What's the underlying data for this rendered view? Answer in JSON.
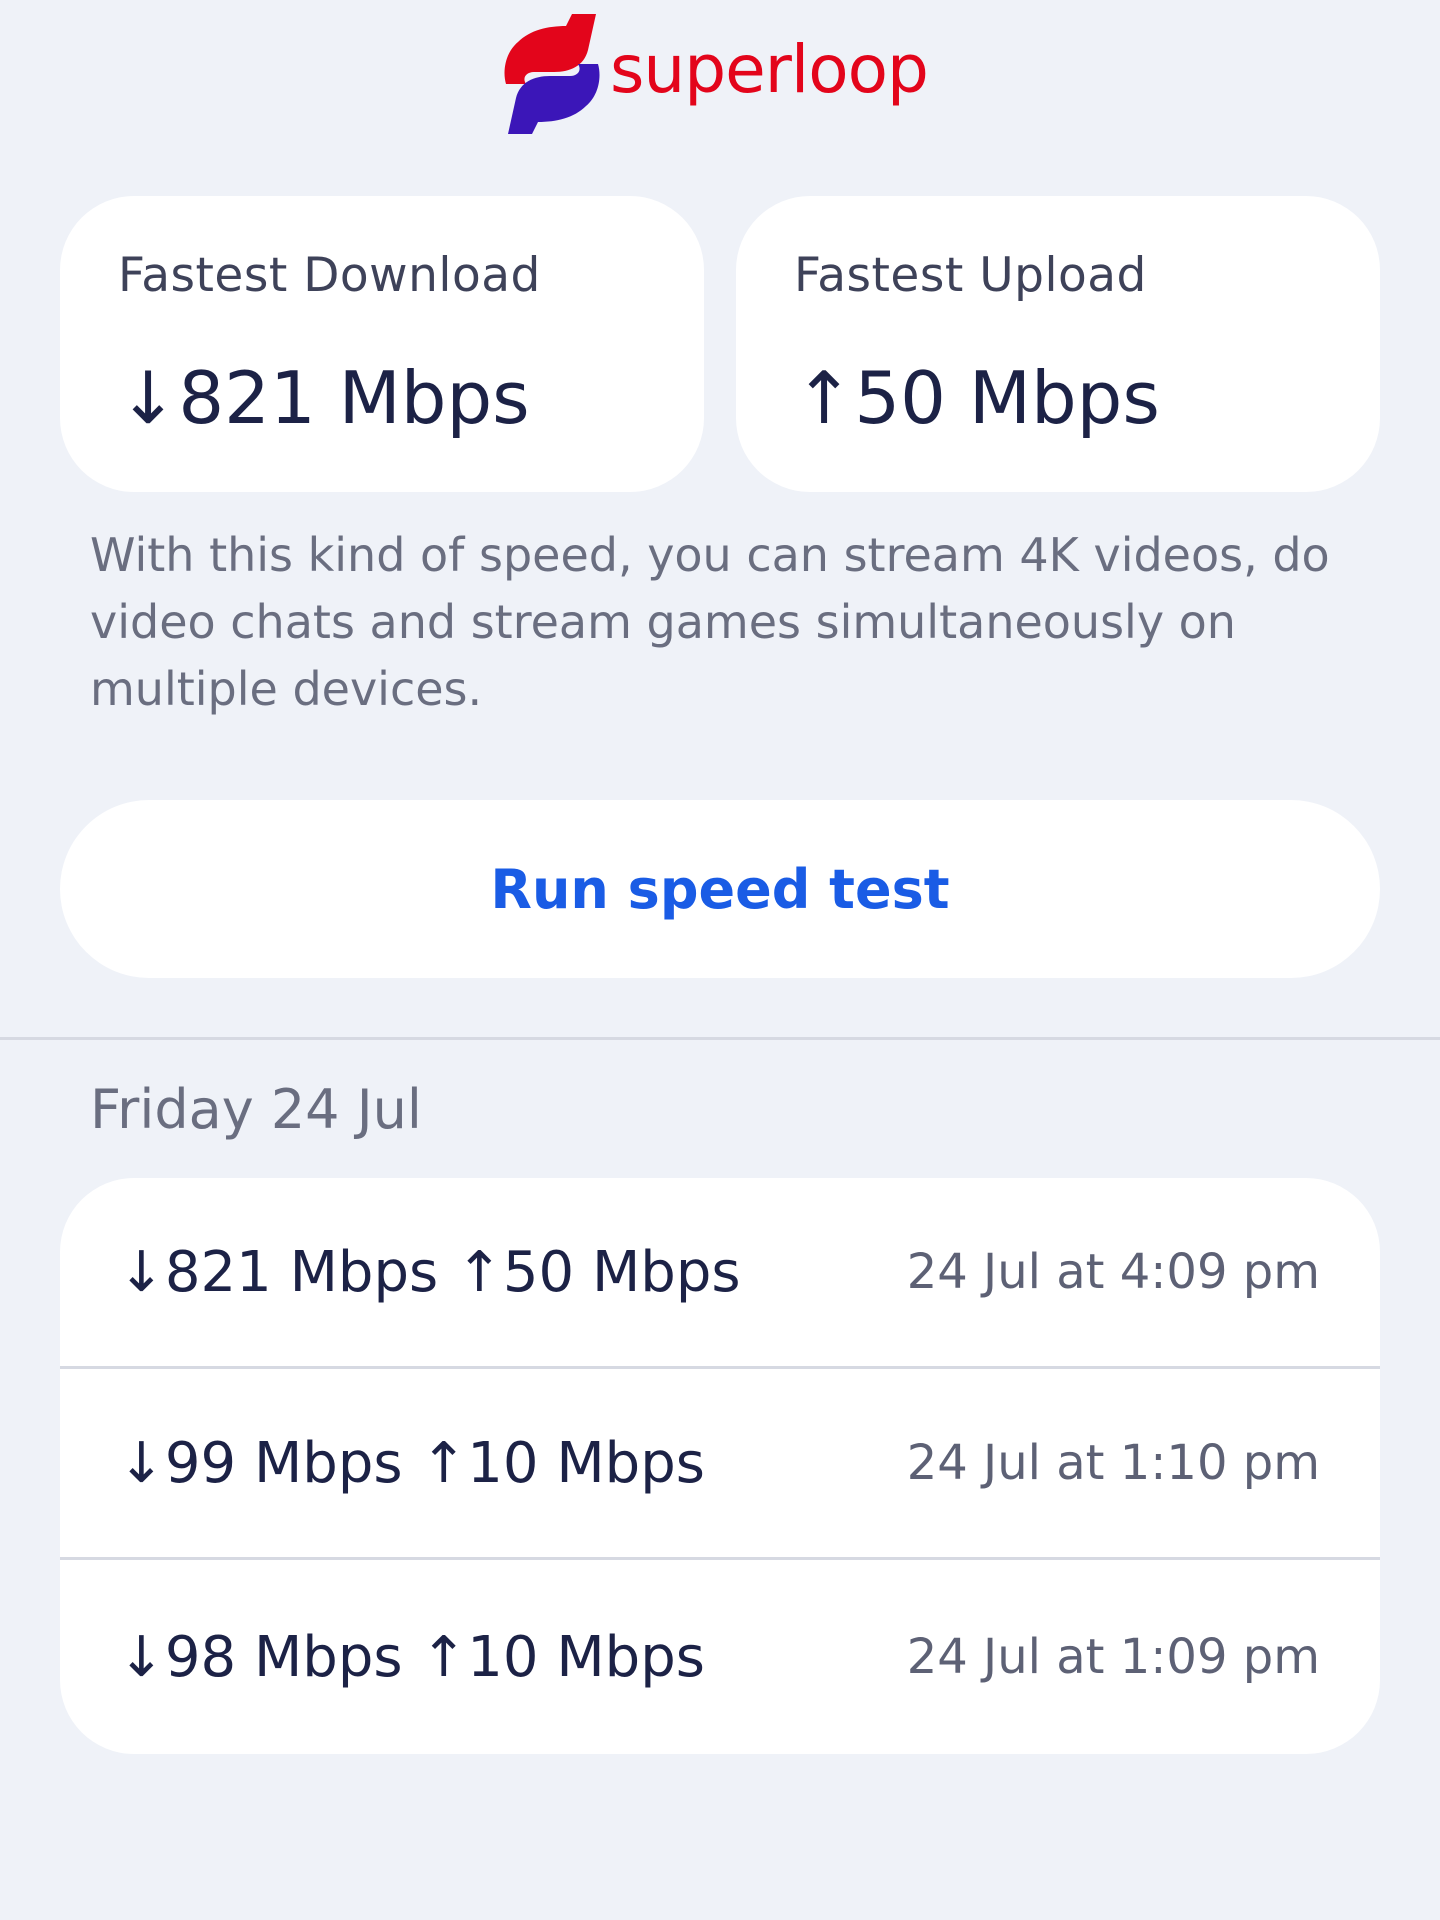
{
  "brand": {
    "name": "superloop",
    "text_color": "#e3051b",
    "icon_top_color": "#e3051b",
    "icon_bottom_color": "#3b16b8",
    "icon": "superloop-s-logo-icon"
  },
  "stats": {
    "download": {
      "label": "Fastest Download",
      "value": "↓821 Mbps"
    },
    "upload": {
      "label": "Fastest Upload",
      "value": "↑50 Mbps"
    }
  },
  "description": "With this kind of speed, you can stream 4K videos, do video chats and stream games simultaneously on multiple devices.",
  "run_button": {
    "label": "Run speed test",
    "color": "#1a5ce5"
  },
  "history": {
    "date_header": "Friday 24 Jul",
    "rows": [
      {
        "speeds": "↓821 Mbps ↑50 Mbps",
        "time": "24 Jul at 4:09 pm"
      },
      {
        "speeds": "↓99 Mbps ↑10 Mbps",
        "time": "24 Jul at 1:10 pm"
      },
      {
        "speeds": "↓98 Mbps ↑10 Mbps",
        "time": "24 Jul at 1:09 pm"
      }
    ]
  }
}
